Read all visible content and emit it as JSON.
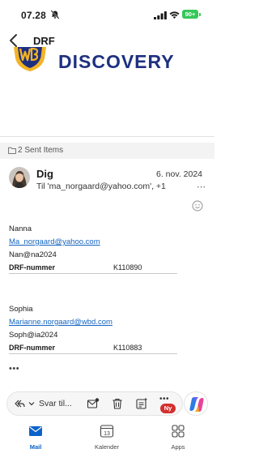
{
  "status_bar": {
    "time": "07.28",
    "battery": "90+"
  },
  "header": {
    "title": "DRF"
  },
  "brand": {
    "text": "DISCOVERY"
  },
  "folder": {
    "label": "2 Sent Items"
  },
  "message": {
    "sender": "Dig",
    "date": "6. nov. 2024",
    "recipients": "Til 'ma_norgaard@yahoo.com', +1",
    "more": "⋯"
  },
  "body": {
    "entries": [
      {
        "name": "Nanna",
        "email": "Ma_norgaard@yahoo.com",
        "password": "Nan@na2024",
        "key": "DRF-nummer",
        "value": "K110890"
      },
      {
        "name": "Sophia",
        "email": "Marianne.norgaard@wbd.com",
        "password": "Soph@ia2024",
        "key": "DRF-nummer",
        "value": "K110883"
      }
    ],
    "ellipsis": "•••"
  },
  "toolbar": {
    "reply_label": "Svar til...",
    "more": "•••",
    "badge": "Ny"
  },
  "tabs": [
    {
      "label": "Mail",
      "icon": "mail-icon"
    },
    {
      "label": "Kalender",
      "icon": "calendar-icon",
      "day": "13"
    },
    {
      "label": "Apps",
      "icon": "apps-icon"
    }
  ],
  "colors": {
    "accent": "#0a63c9",
    "link": "#1565c0",
    "brand": "#1e3080",
    "battery": "#34c759",
    "badge": "#d32f2f"
  }
}
